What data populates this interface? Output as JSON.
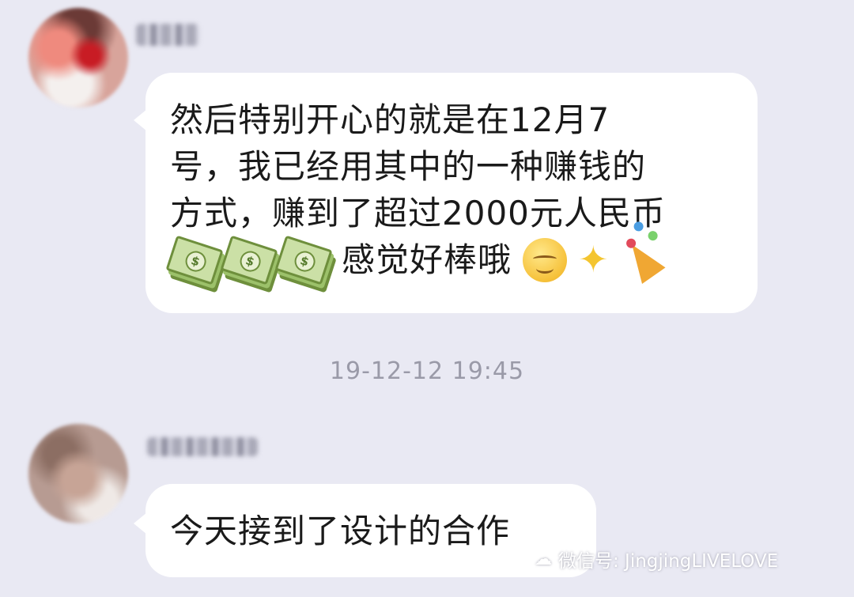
{
  "messages": [
    {
      "lines": [
        "然后特别开心的就是在12月7",
        "号，我已经用其中的一种赚钱的",
        "方式，赚到了超过2000元人民币"
      ],
      "tail_text": "感觉好棒哦",
      "emojis": [
        "money-with-wings-emoji",
        "money-with-wings-emoji",
        "money-with-wings-emoji",
        "smiling-face-emoji",
        "sparkles-emoji",
        "party-popper-emoji"
      ]
    },
    {
      "text": "今天接到了设计的合作"
    }
  ],
  "timestamp": "19-12-12 19:45",
  "watermark": {
    "icon": "wechat-icon",
    "text": "微信号: JingjingLIVELOVE"
  },
  "colors": {
    "background": "#e9e9f3",
    "bubble": "#ffffff",
    "timestamp": "#9a9aa8"
  }
}
